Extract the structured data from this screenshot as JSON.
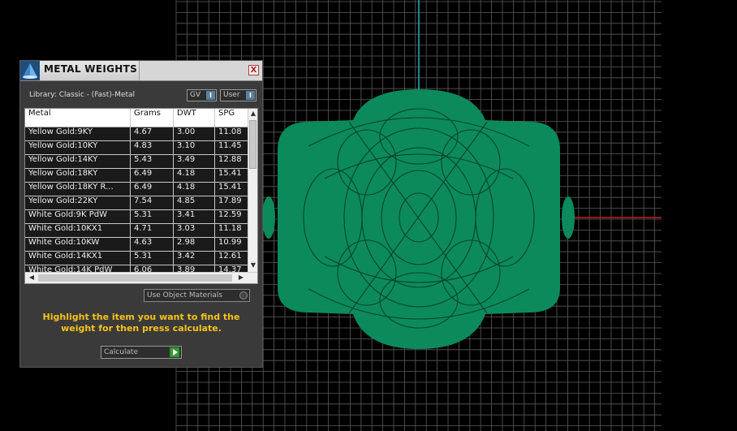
{
  "panel": {
    "title": "METAL WEIGHTS",
    "close_label": "X",
    "library_label": "Library: Classic - (Fast)-Metal",
    "gv_toggle": "GV",
    "user_toggle": "User",
    "use_object_materials": "Use Object Materials",
    "instruction": "Highlight the item you want to find the weight for then press calculate.",
    "calculate_label": "Calculate"
  },
  "table": {
    "headers": [
      "Metal",
      "Grams",
      "DWT",
      "SPG"
    ],
    "rows": [
      [
        "Yellow Gold:9KY",
        "4.67",
        "3.00",
        "11.08"
      ],
      [
        "Yellow Gold:10KY",
        "4.83",
        "3.10",
        "11.45"
      ],
      [
        "Yellow Gold:14KY",
        "5.43",
        "3.49",
        "12.88"
      ],
      [
        "Yellow Gold:18KY",
        "6.49",
        "4.18",
        "15.41"
      ],
      [
        "Yellow Gold:18KY R...",
        "6.49",
        "4.18",
        "15.41"
      ],
      [
        "Yellow Gold:22KY",
        "7.54",
        "4.85",
        "17.89"
      ],
      [
        "White Gold:9K PdW",
        "5.31",
        "3.41",
        "12.59"
      ],
      [
        "White Gold:10KX1",
        "4.71",
        "3.03",
        "11.18"
      ],
      [
        "White Gold:10KW",
        "4.63",
        "2.98",
        "10.99"
      ],
      [
        "White Gold:14KX1",
        "5.31",
        "3.42",
        "12.61"
      ],
      [
        "White Gold:14K PdW",
        "6.06",
        "3.89",
        "14.37"
      ]
    ]
  },
  "viewport": {
    "background": "#000000",
    "grid_color": "#5a5a5a",
    "model_color": "#0c8a5c",
    "axis_y_color": "#22b3b3",
    "axis_x_color": "#c02020"
  },
  "icons": {
    "app_logo": "app-logo-icon",
    "close": "close-icon",
    "calculate": "play-icon"
  }
}
